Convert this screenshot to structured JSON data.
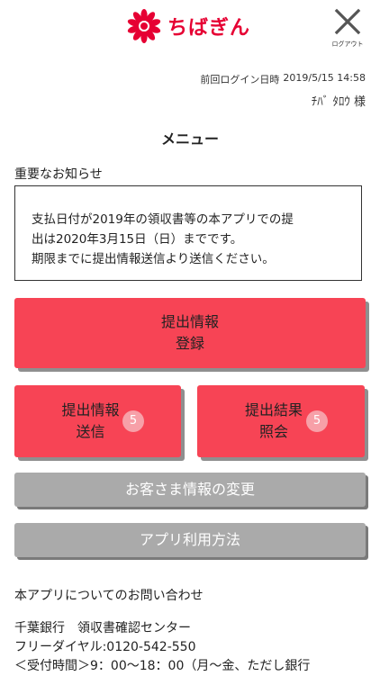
{
  "header": {
    "logo_text": "ちばぎん",
    "logout_label": "ログアウト",
    "brand_color": "#e60033"
  },
  "login": {
    "label": "前回ログイン日時",
    "datetime": "2019/5/15 14:58",
    "user_name": "ﾁﾊﾞ ﾀﾛｳ 様"
  },
  "menu": {
    "title": "メニュー"
  },
  "notice": {
    "heading": "重要なお知らせ",
    "lines": [
      "支払日付が2019年の領収書等の本アプリでの提",
      "出は2020年3月15日（日）までです。",
      "期限までに提出情報送信より送信ください。"
    ]
  },
  "buttons": {
    "register": {
      "line1": "提出情報",
      "line2": "登録"
    },
    "send": {
      "line1": "提出情報",
      "line2": "送信",
      "badge": "5"
    },
    "result": {
      "line1": "提出結果",
      "line2": "照会",
      "badge": "5"
    },
    "change_info": "お客さま情報の変更",
    "how_to_use": "アプリ利用方法",
    "accent_color": "#f74455",
    "gray_color": "#aaaaaa"
  },
  "contact": {
    "heading": "本アプリについてのお問い合わせ",
    "lines": [
      "千葉銀行　領収書確認センター",
      "フリーダイヤル:0120-542-550",
      "＜受付時間＞9：00〜18：00（月〜金、ただし銀行"
    ]
  },
  "icons": {
    "logo": "chibagin-flower-icon",
    "logout": "close-x-icon"
  }
}
